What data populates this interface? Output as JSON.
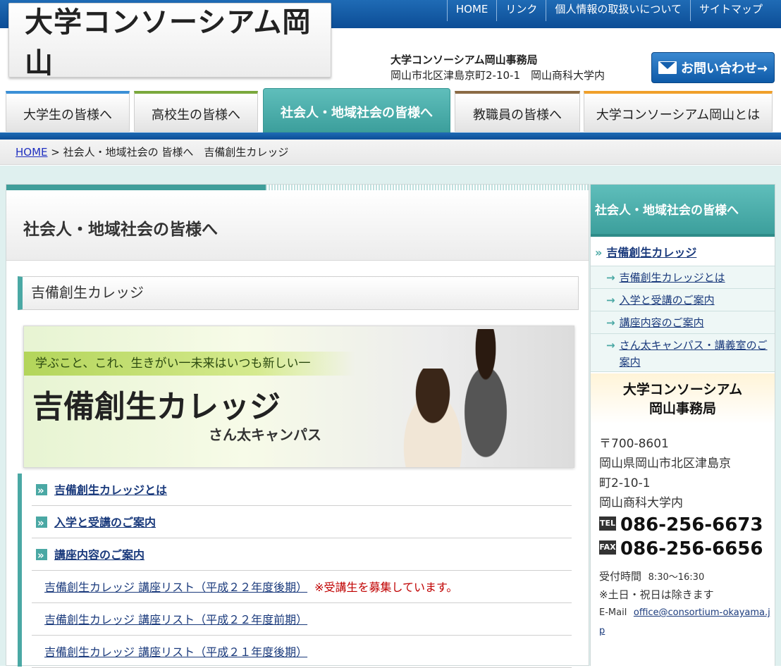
{
  "header": {
    "logo_text": "大学コンソーシアム岡山",
    "topnav": [
      "HOME",
      "リンク",
      "個人情報の取扱いについて",
      "サイトマップ"
    ],
    "office_name": "大学コンソーシアム岡山事務局",
    "office_address": "岡山市北区津島京町2-10-1　岡山商科大学内",
    "contact_button": "お問い合わせ→"
  },
  "mainnav": {
    "tabs": [
      "大学生の皆様へ",
      "高校生の皆様へ",
      "社会人・地域社会の皆様へ",
      "教職員の皆様へ",
      "大学コンソーシアム岡山とは"
    ],
    "active_index": 2
  },
  "breadcrumb": {
    "home": "HOME",
    "sep": " > ",
    "path": "社会人・地域社会の 皆様へ　吉備創生カレッジ"
  },
  "main": {
    "page_heading": "社会人・地域社会の皆様へ",
    "sub_heading": "吉備創生カレッジ",
    "banner": {
      "tagline": "学ぶこと、これ、生きがい一未来はいつも新しい一",
      "title": "吉備創生カレッジ",
      "subtitle": "さん太キャンパス"
    },
    "links": [
      "吉備創生カレッジとは",
      "入学と受講のご案内",
      "講座内容のご案内"
    ],
    "sub_links": [
      "吉備創生カレッジ 講座リスト（平成２２年度後期）",
      "吉備創生カレッジ 講座リスト（平成２２年度前期）",
      "吉備創生カレッジ 講座リスト（平成２１年度後期）"
    ],
    "recruit_note": "※受講生を募集しています。"
  },
  "sidebar": {
    "heading": "社会人・地域社会の皆様へ",
    "main_link": "吉備創生カレッジ",
    "sub_links": [
      "吉備創生カレッジとは",
      "入学と受講のご案内",
      "講座内容のご案内",
      "さん太キャンパス・講義室のご案内"
    ],
    "office": {
      "name_line1": "大学コンソーシアム",
      "name_line2": "岡山事務局",
      "postal": "〒700-8601",
      "addr1": "岡山県岡山市北区津島京",
      "addr2": "町2-10-1",
      "addr3": "岡山商科大学内",
      "tel_label": "TEL",
      "tel": "086-256-6673",
      "fax_label": "FAX",
      "fax": "086-256-6656",
      "hours_label": "受付時間",
      "hours": "8:30〜16:30",
      "closed": "※土日・祝日は除きます",
      "email_label": "E-Mail",
      "email": "office@consortium-okayama.jp"
    }
  },
  "colors": {
    "brand_blue": "#0c4d96",
    "teal": "#3c9f9c",
    "recruit_red": "#c00000"
  }
}
